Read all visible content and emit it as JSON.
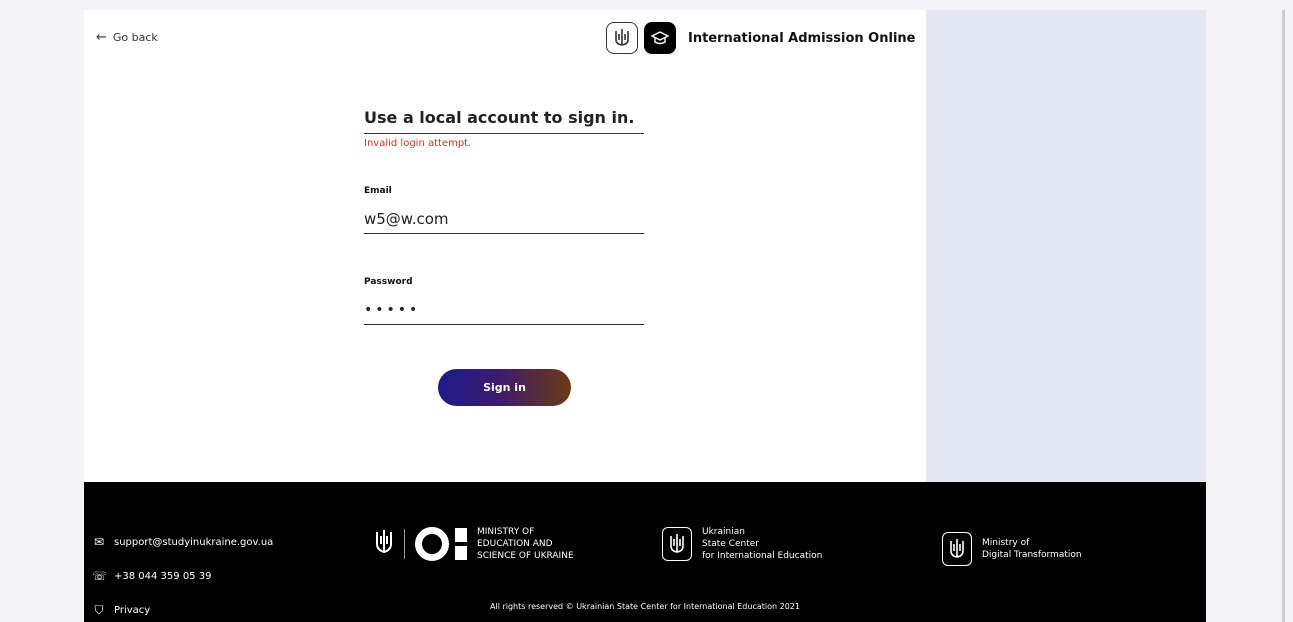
{
  "nav": {
    "go_back": "Go back"
  },
  "brand": {
    "title": "International Admission Online"
  },
  "form": {
    "heading": "Use a local account to sign in.",
    "error": "Invalid login attempt.",
    "email_label": "Email",
    "email_value": "w5@w.com",
    "password_label": "Password",
    "password_value": "•••••",
    "submit_label": "Sign in"
  },
  "footer": {
    "email": "support@studyinukraine.gov.ua",
    "phone": "+38 044 359 05 39",
    "privacy": "Privacy",
    "ministry_education": [
      "MINISTRY OF",
      "EDUCATION AND",
      "SCIENCE OF UKRAINE"
    ],
    "state_center": [
      "Ukrainian",
      "State Center",
      "for International Education"
    ],
    "digital_ministry": [
      "Ministry of",
      "Digital Transformation"
    ],
    "copyright": "All rights reserved © Ukrainian State Center for International Education 2021"
  },
  "icons": {
    "back": "arrow-left-icon",
    "mail": "mail-icon",
    "phone": "phone-icon",
    "privacy": "shield-icon",
    "trident": "trident-icon"
  },
  "colors": {
    "error": "#c0392b",
    "button_start": "#1e1b8a",
    "button_end": "#6b3a12",
    "side_panel": "#e3e7f1"
  }
}
